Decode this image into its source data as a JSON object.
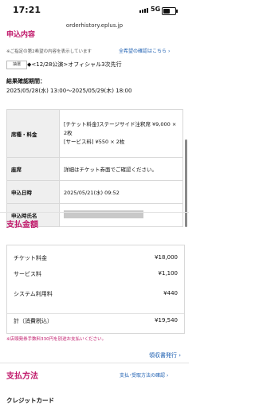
{
  "status_bar": {
    "time": "17:21",
    "network": "5G"
  },
  "browser": {
    "url": "orderhistory.eplus.jp"
  },
  "application_section": {
    "title": "申込内容",
    "note": "※ご指定の第2希望の内容を表示しています",
    "link": "全希望の確認はこちら",
    "lottery_tag": "抽選",
    "event": "◆<12/28公演>オフィシャル3次先行",
    "period_label": "結果確認期間：",
    "period_value": "2025/05/28(水) 13:00～2025/05/29(木) 18:00",
    "rows": [
      {
        "label": "席種・料金",
        "value": "[チケット料金]ステージサイド注釈席 ¥9,000 × 2枚\n[サービス料] ¥550 × 2枚"
      },
      {
        "label": "座席",
        "value": "詳細はチケット券面でご確認ください。"
      },
      {
        "label": "申込日時",
        "value": "2025/05/21(水) 09:52"
      },
      {
        "label": "申込時氏名",
        "value": ""
      }
    ]
  },
  "payment_amount": {
    "title": "支払金額",
    "rows": [
      {
        "label": "チケット料金",
        "value": "¥18,000"
      },
      {
        "label": "サービス料",
        "value": "¥1,100"
      },
      {
        "label": "システム利用料",
        "value": "¥440"
      }
    ],
    "total_label": "計（消費税込）",
    "total_value": "¥19,540",
    "note": "※店頭発券手数料330円を別途お支払いください。",
    "receipt_link": "領収書発行"
  },
  "payment_method": {
    "title": "支払方法",
    "link": "支払･受取方法の確認",
    "value": "クレジットカード"
  }
}
